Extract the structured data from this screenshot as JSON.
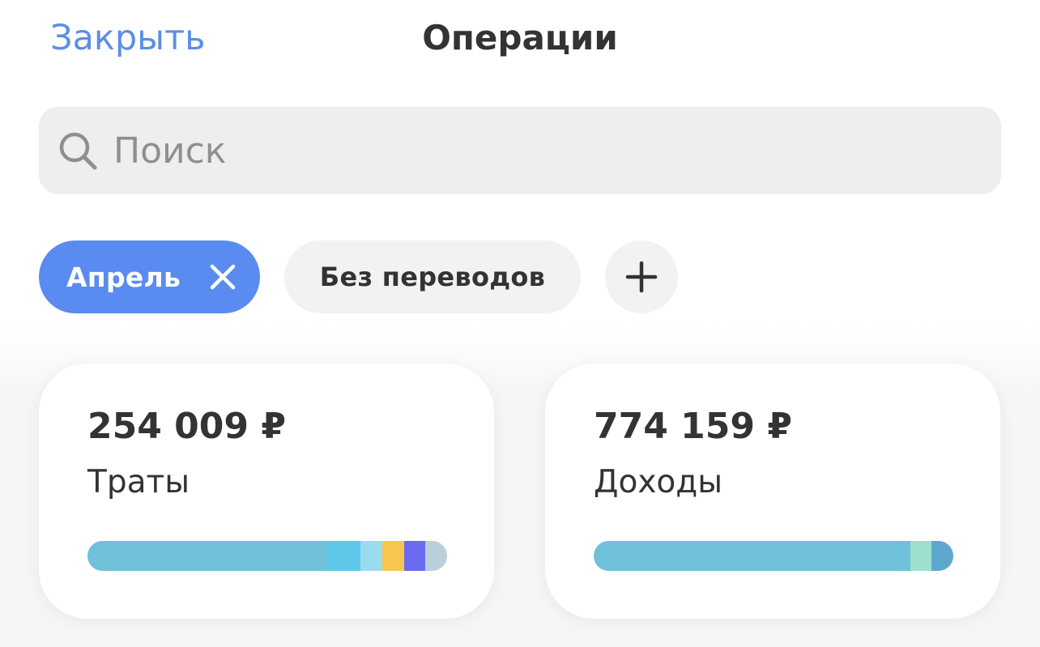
{
  "header": {
    "close_label": "Закрыть",
    "title": "Операции"
  },
  "search": {
    "placeholder": "Поиск",
    "value": ""
  },
  "filters": {
    "month_label": "Апрель",
    "transfers_label": "Без переводов"
  },
  "summary": {
    "expenses": {
      "amount": "254 009 ₽",
      "label": "Траты",
      "breakdown": [
        {
          "share": 0.67,
          "color": "#6ec1d9"
        },
        {
          "share": 0.09,
          "color": "#5ec8ea"
        },
        {
          "share": 0.06,
          "color": "#9bdbef"
        },
        {
          "share": 0.06,
          "color": "#f6c64e"
        },
        {
          "share": 0.06,
          "color": "#6c6af0"
        },
        {
          "share": 0.06,
          "color": "#b9cfdc"
        }
      ]
    },
    "income": {
      "amount": "774 159 ₽",
      "label": "Доходы",
      "breakdown": [
        {
          "share": 0.88,
          "color": "#6ec1d9"
        },
        {
          "share": 0.06,
          "color": "#9ee0cd"
        },
        {
          "share": 0.06,
          "color": "#5da8cc"
        }
      ]
    }
  },
  "colors": {
    "accent": "#5a8bf0",
    "link": "#5b8de8"
  }
}
